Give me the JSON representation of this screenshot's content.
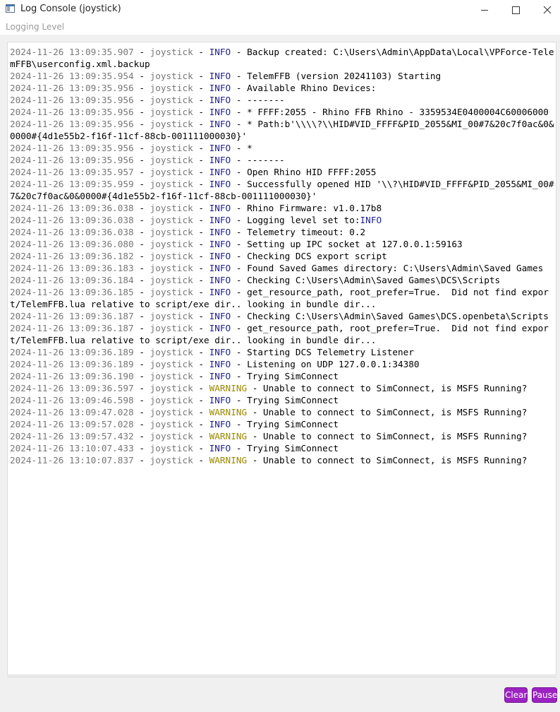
{
  "window": {
    "title": "Log Console (joystick)",
    "icon": "app-window-icon",
    "controls": {
      "minimize": "minimize-icon",
      "maximize": "maximize-icon",
      "close": "close-icon"
    }
  },
  "menu": {
    "items": [
      "Logging Level"
    ]
  },
  "log": {
    "sep": " - ",
    "level_colors": {
      "INFO": "#1e1e8c",
      "WARNING": "#9a8a00"
    },
    "entries": [
      {
        "ts": "2024-11-26 13:09:35.907",
        "src": "joystick",
        "level": "INFO",
        "msg": "Backup created: C:\\Users\\Admin\\AppData\\Local\\VPForce-TelemFFB\\userconfig.xml.backup"
      },
      {
        "ts": "2024-11-26 13:09:35.954",
        "src": "joystick",
        "level": "INFO",
        "msg": "TelemFFB (version 20241103) Starting"
      },
      {
        "ts": "2024-11-26 13:09:35.956",
        "src": "joystick",
        "level": "INFO",
        "msg": "Available Rhino Devices:"
      },
      {
        "ts": "2024-11-26 13:09:35.956",
        "src": "joystick",
        "level": "INFO",
        "msg": "-------"
      },
      {
        "ts": "2024-11-26 13:09:35.956",
        "src": "joystick",
        "level": "INFO",
        "msg": "* FFFF:2055 - Rhino FFB Rhino - 3359534E0400004C60006000"
      },
      {
        "ts": "2024-11-26 13:09:35.956",
        "src": "joystick",
        "level": "INFO",
        "msg": "* Path:b'\\\\\\\\?\\\\HID#VID_FFFF&PID_2055&MI_00#7&20c7f0ac&0&0000#{4d1e55b2-f16f-11cf-88cb-001111000030}'"
      },
      {
        "ts": "2024-11-26 13:09:35.956",
        "src": "joystick",
        "level": "INFO",
        "msg": "*"
      },
      {
        "ts": "2024-11-26 13:09:35.956",
        "src": "joystick",
        "level": "INFO",
        "msg": "-------"
      },
      {
        "ts": "2024-11-26 13:09:35.957",
        "src": "joystick",
        "level": "INFO",
        "msg": "Open Rhino HID FFFF:2055"
      },
      {
        "ts": "2024-11-26 13:09:35.959",
        "src": "joystick",
        "level": "INFO",
        "msg": "Successfully opened HID '\\\\?\\HID#VID_FFFF&PID_2055&MI_00#7&20c7f0ac&0&0000#{4d1e55b2-f16f-11cf-88cb-001111000030}'"
      },
      {
        "ts": "2024-11-26 13:09:36.038",
        "src": "joystick",
        "level": "INFO",
        "msg": "Rhino Firmware: v1.0.17b8"
      },
      {
        "ts": "2024-11-26 13:09:36.038",
        "src": "joystick",
        "level": "INFO",
        "msg": "Logging level set to:",
        "msg_level": "INFO"
      },
      {
        "ts": "2024-11-26 13:09:36.038",
        "src": "joystick",
        "level": "INFO",
        "msg": "Telemetry timeout: 0.2"
      },
      {
        "ts": "2024-11-26 13:09:36.080",
        "src": "joystick",
        "level": "INFO",
        "msg": "Setting up IPC socket at 127.0.0.1:59163"
      },
      {
        "ts": "2024-11-26 13:09:36.182",
        "src": "joystick",
        "level": "INFO",
        "msg": "Checking DCS export script"
      },
      {
        "ts": "2024-11-26 13:09:36.183",
        "src": "joystick",
        "level": "INFO",
        "msg": "Found Saved Games directory: C:\\Users\\Admin\\Saved Games"
      },
      {
        "ts": "2024-11-26 13:09:36.184",
        "src": "joystick",
        "level": "INFO",
        "msg": "Checking C:\\Users\\Admin\\Saved Games\\DCS\\Scripts"
      },
      {
        "ts": "2024-11-26 13:09:36.185",
        "src": "joystick",
        "level": "INFO",
        "msg": "get_resource_path, root_prefer=True.  Did not find export/TelemFFB.lua relative to script/exe dir.. looking in bundle dir..."
      },
      {
        "ts": "2024-11-26 13:09:36.187",
        "src": "joystick",
        "level": "INFO",
        "msg": "Checking C:\\Users\\Admin\\Saved Games\\DCS.openbeta\\Scripts"
      },
      {
        "ts": "2024-11-26 13:09:36.187",
        "src": "joystick",
        "level": "INFO",
        "msg": "get_resource_path, root_prefer=True.  Did not find export/TelemFFB.lua relative to script/exe dir.. looking in bundle dir..."
      },
      {
        "ts": "2024-11-26 13:09:36.189",
        "src": "joystick",
        "level": "INFO",
        "msg": "Starting DCS Telemetry Listener"
      },
      {
        "ts": "2024-11-26 13:09:36.189",
        "src": "joystick",
        "level": "INFO",
        "msg": "Listening on UDP 127.0.0.1:34380"
      },
      {
        "ts": "2024-11-26 13:09:36.190",
        "src": "joystick",
        "level": "INFO",
        "msg": "Trying SimConnect"
      },
      {
        "ts": "2024-11-26 13:09:36.597",
        "src": "joystick",
        "level": "WARNING",
        "msg": "Unable to connect to SimConnect, is MSFS Running?"
      },
      {
        "ts": "2024-11-26 13:09:46.598",
        "src": "joystick",
        "level": "INFO",
        "msg": "Trying SimConnect"
      },
      {
        "ts": "2024-11-26 13:09:47.028",
        "src": "joystick",
        "level": "WARNING",
        "msg": "Unable to connect to SimConnect, is MSFS Running?"
      },
      {
        "ts": "2024-11-26 13:09:57.028",
        "src": "joystick",
        "level": "INFO",
        "msg": "Trying SimConnect"
      },
      {
        "ts": "2024-11-26 13:09:57.432",
        "src": "joystick",
        "level": "WARNING",
        "msg": "Unable to connect to SimConnect, is MSFS Running?"
      },
      {
        "ts": "2024-11-26 13:10:07.433",
        "src": "joystick",
        "level": "INFO",
        "msg": "Trying SimConnect"
      },
      {
        "ts": "2024-11-26 13:10:07.837",
        "src": "joystick",
        "level": "WARNING",
        "msg": "Unable to connect to SimConnect, is MSFS Running?"
      }
    ]
  },
  "buttons": {
    "clear": "Clear",
    "pause": "Pause",
    "color": "#9c22c2"
  }
}
